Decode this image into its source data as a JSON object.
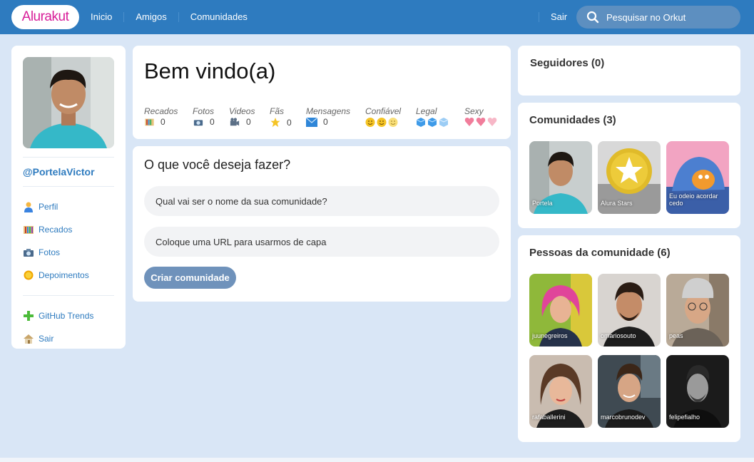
{
  "header": {
    "logo": "Alurakut",
    "nav": [
      "Inicio",
      "Amigos",
      "Comunidades"
    ],
    "logout": "Sair",
    "search_placeholder": "Pesquisar no Orkut"
  },
  "profile": {
    "username": "@PortelaVictor",
    "menu": [
      {
        "label": "Perfil",
        "icon": "user-icon"
      },
      {
        "label": "Recados",
        "icon": "book-icon"
      },
      {
        "label": "Fotos",
        "icon": "camera-icon"
      },
      {
        "label": "Depoimentos",
        "icon": "sun-icon"
      }
    ],
    "menu2": [
      {
        "label": "GitHub Trends",
        "icon": "plus-icon"
      },
      {
        "label": "Sair",
        "icon": "house-icon"
      }
    ]
  },
  "welcome": {
    "title": "Bem vindo(a)",
    "stats": [
      {
        "label": "Recados",
        "value": "0",
        "icon": "book-icon"
      },
      {
        "label": "Fotos",
        "value": "0",
        "icon": "camera-icon"
      },
      {
        "label": "Videos",
        "value": "0",
        "icon": "video-camera-icon"
      },
      {
        "label": "Fãs",
        "value": "0",
        "icon": "star-icon"
      },
      {
        "label": "Mensagens",
        "value": "0",
        "icon": "envelope-icon"
      },
      {
        "label": "Confiável",
        "icon": "smiley-icon"
      },
      {
        "label": "Legal",
        "icon": "ice-cube-icon"
      },
      {
        "label": "Sexy",
        "icon": "heart-icon"
      }
    ]
  },
  "create": {
    "title": "O que você deseja fazer?",
    "name_placeholder": "Qual vai ser o nome da sua comunidade?",
    "url_placeholder": "Coloque uma URL para usarmos de capa",
    "button": "Criar comunidade"
  },
  "followers": {
    "title": "Seguidores (0)"
  },
  "communities": {
    "title": "Comunidades (3)",
    "items": [
      "Portela",
      "Alura Stars",
      "Eu odeio acordar cedo"
    ]
  },
  "people": {
    "title": "Pessoas da comunidade (6)",
    "items": [
      "juunegreiros",
      "omariosouto",
      "peas",
      "rafaballerini",
      "marcobrunodev",
      "felipefialho"
    ]
  }
}
